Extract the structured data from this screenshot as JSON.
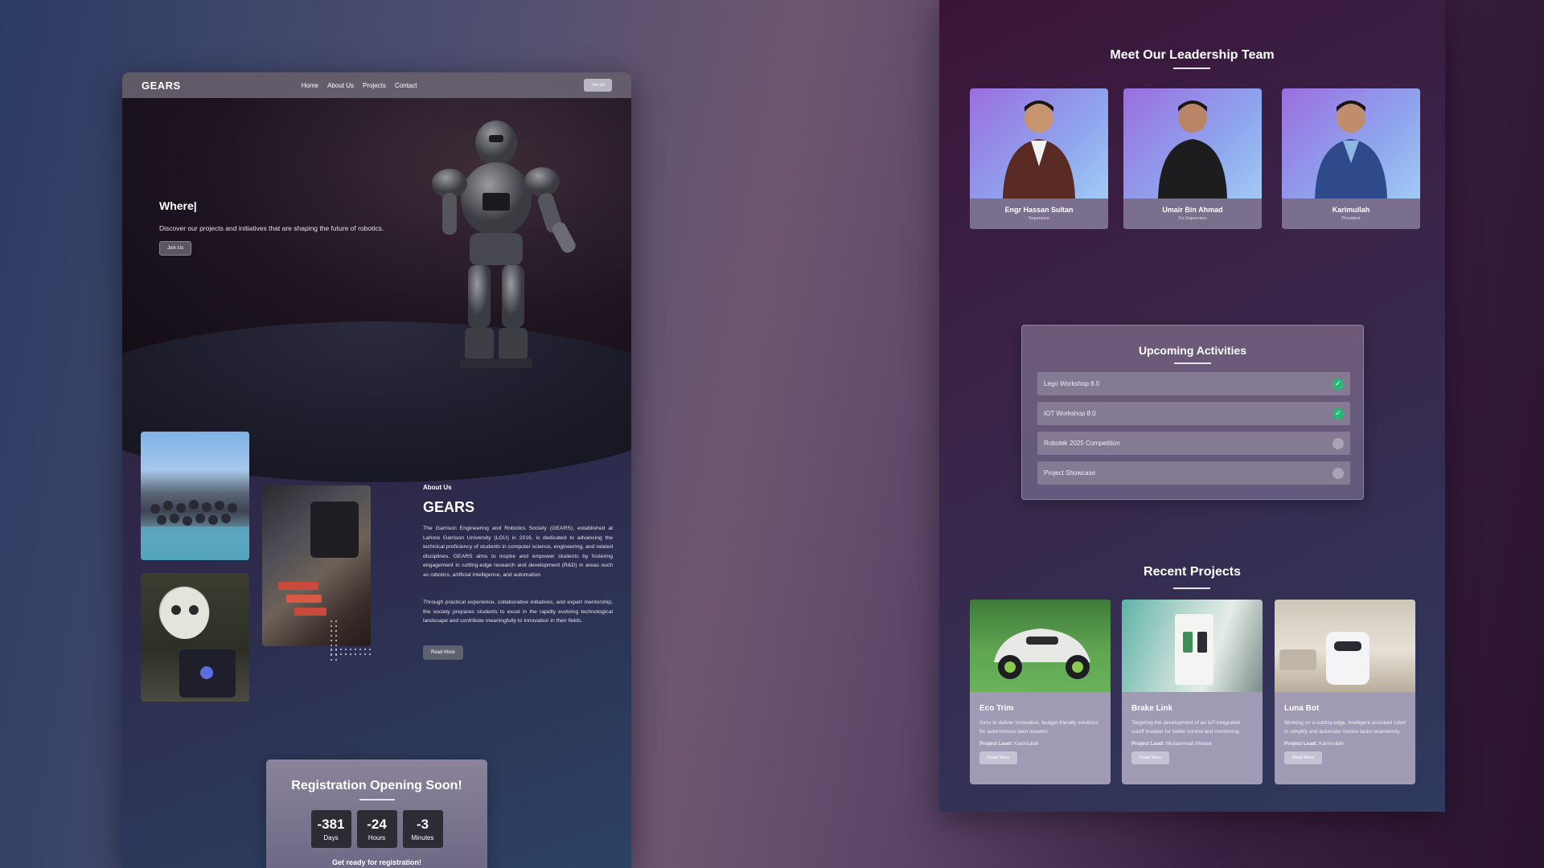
{
  "left_page": {
    "nav": {
      "brand": "GEARS",
      "links": [
        "Home",
        "About Us",
        "Projects",
        "Contact"
      ],
      "join_label": "Join Us"
    },
    "hero": {
      "title": "Where|",
      "subtitle": "Discover our projects and initiatives that are shaping the future of robotics.",
      "button_label": "Join Us"
    },
    "about": {
      "kicker": "About Us",
      "title": "GEARS",
      "paragraph_1": "The Garrison Engineering and Robotics Society (GEARS), established at Lahore Garrison University (LGU) in 2016, is dedicated to advancing the technical proficiency of students in computer science, engineering, and related disciplines. GEARS aims to inspire and empower students by fostering engagement in cutting-edge research and development (R&D) in areas such as robotics, artificial intelligence, and automation",
      "paragraph_2": "Through practical experience, collaborative initiatives, and expert mentorship, the society prepares students to excel in the rapidly evolving technological landscape and contribute meaningfully to innovation in their fields.",
      "button_label": "Read More"
    },
    "registration": {
      "title": "Registration Opening Soon!",
      "countdown": [
        {
          "value": "-381",
          "unit": "Days"
        },
        {
          "value": "-24",
          "unit": "Hours"
        },
        {
          "value": "-3",
          "unit": "Minutes"
        }
      ],
      "footer": "Get ready for registration!"
    }
  },
  "right_page": {
    "leadership": {
      "title": "Meet Our Leadership Team",
      "members": [
        {
          "name": "Engr Hassan Sultan",
          "role": "Supervisor"
        },
        {
          "name": "Umair Bin Ahmad",
          "role": "Co-Supervisor"
        },
        {
          "name": "Karimullah",
          "role": "President"
        }
      ]
    },
    "activities": {
      "title": "Upcoming Activities",
      "items": [
        {
          "label": "Lego Workshop 8.0",
          "done": true
        },
        {
          "label": "IOT Workshop 8.0",
          "done": true
        },
        {
          "label": "Robotek 2025 Competition",
          "done": false
        },
        {
          "label": "Project Showcase",
          "done": false
        }
      ],
      "check_glyph": "✓"
    },
    "projects": {
      "title": "Recent Projects",
      "lead_prefix": "Project Lead:",
      "items": [
        {
          "title": "Eco Trim",
          "description": "Aims to deliver innovative, budget-friendly solutions for autonomous lawn mowers.",
          "lead": "Karimullah",
          "button": "Read More"
        },
        {
          "title": "Brake Link",
          "description": "Targeting the development of an IoT-integrated cutoff breaker for better control and monitoring.",
          "lead": "Muhammad Ahmed",
          "button": "Read More"
        },
        {
          "title": "Luna Bot",
          "description": "Working on a cutting-edge, intelligent assistant robot to simplify and automate routine tasks seamlessly.",
          "lead": "Karimullah",
          "button": "Read More"
        }
      ]
    }
  }
}
